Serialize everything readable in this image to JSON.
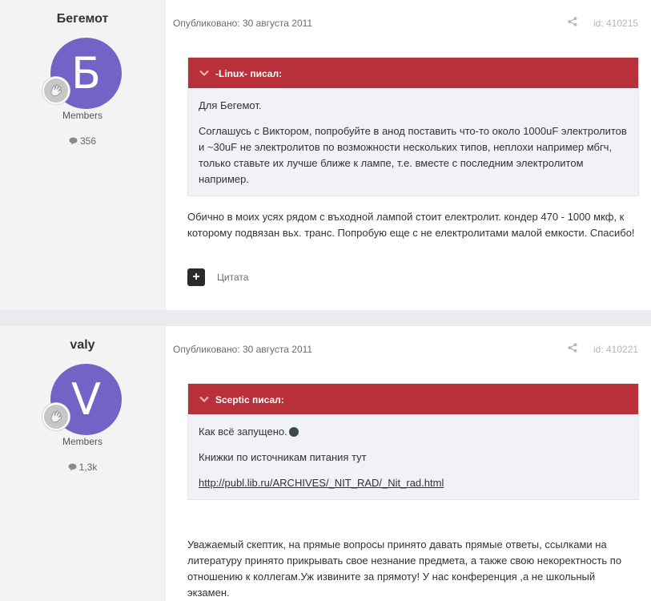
{
  "posts": [
    {
      "author": "Бегемот",
      "avatar_letter": "Б",
      "avatar_color": "#7164c6",
      "group": "Members",
      "post_count": "356",
      "published": "Опубликовано: 30 августа 2011",
      "post_id": "id: 410215",
      "quote": {
        "header": "-Linux- писал:",
        "lines": [
          "Для Бегемот.",
          "Соглашусь с Виктором, попробуйте в анод поставить что-то около 1000uF электролитов и ~30uF не электролитов по возможности нескольких типов, неплохи например мбгч, только ставьте их лучше ближе к лампе, т.е. вместе с последним электролитом например."
        ]
      },
      "body": "Обичнo в моих усях рядом с въходной лампой стоит електролит. кондер 470 - 1000 мкф, к которому подвязан вьх. транс. Попробую еще с не електролитами малой емкости. Спасибо!",
      "quote_button_label": "Цитата"
    },
    {
      "author": "valy",
      "avatar_letter": "V",
      "avatar_color": "#7164c6",
      "group": "Members",
      "post_count": "1,3k",
      "published": "Опубликовано: 30 августа 2011",
      "post_id": "id: 410221",
      "quote": {
        "header": "Sceptic писал:",
        "line1": "Как всё запущено.",
        "line2": "Книжки по источникам питания тут",
        "link": "http://publ.lib.ru/ARCHIVES/_NIT_RAD/_Nit_rad.html"
      },
      "body": "Уважаемый скептик, на прямые вопросы принято давать прямые ответы, ссылками на литературу принято прикрывать свое незнание предмета, а также свою некоректность по отношению к коллегам.Уж извините за прямоту! У нас конференция ,а не школьный экзамен."
    }
  ],
  "colors": {
    "quote_header": "#b8303a",
    "avatar": "#7164c6",
    "author_panel": "#f3f3f4"
  },
  "icons": {
    "rank": "hand-badge-icon",
    "count": "speech-bubble-icon",
    "share": "share-icon",
    "quote_toggle": "chevron-down-icon",
    "quote_button": "plus-icon"
  }
}
